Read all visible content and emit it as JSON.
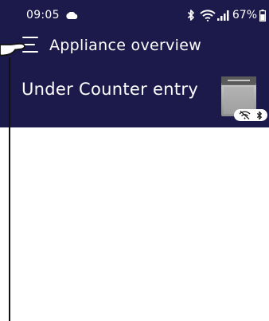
{
  "status_bar": {
    "time": "09:05",
    "battery": "67%",
    "icons": [
      "cloud-icon",
      "bluetooth-icon",
      "wifi-icon",
      "signal-icon",
      "battery-icon"
    ]
  },
  "header": {
    "title": "Appliance overview",
    "menu_icon": "hamburger-menu-icon"
  },
  "appliance": {
    "name": "Under Counter entry",
    "image": "dishwasher-image",
    "status_icons": [
      "wifi-off-icon",
      "bluetooth-icon"
    ]
  },
  "colors": {
    "header_background": "#1c1a4a",
    "header_text": "#ffffff",
    "content_background": "#ffffff"
  }
}
